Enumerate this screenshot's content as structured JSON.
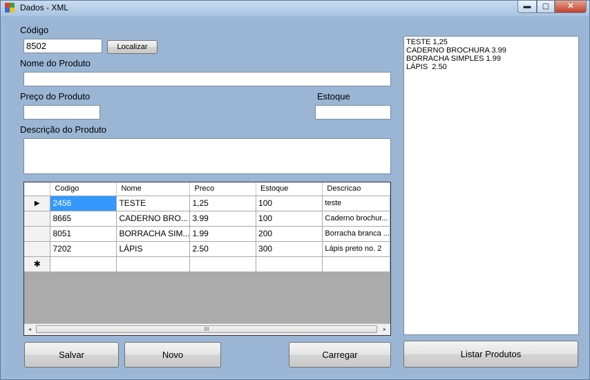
{
  "window": {
    "title": "Dados - XML",
    "min_glyph": "▬",
    "max_glyph": "▢",
    "close_glyph": "✕"
  },
  "form": {
    "codigo_label": "Código",
    "codigo_value": "8502",
    "localizar_label": "Localizar",
    "nome_label": "Nome do Produto",
    "nome_value": "",
    "preco_label": "Preço do Produto",
    "preco_value": "",
    "estoque_label": "Estoque",
    "estoque_value": "",
    "descricao_label": "Descrição do Produto",
    "descricao_value": ""
  },
  "grid": {
    "columns": [
      "Codigo",
      "Nome",
      "Preco",
      "Estoque",
      "Descricao"
    ],
    "rows": [
      {
        "indicator": "▶",
        "codigo": "2456",
        "nome": "TESTE",
        "preco": "1,25",
        "estoque": "100",
        "descricao": "teste"
      },
      {
        "indicator": "",
        "codigo": "8665",
        "nome": "CADERNO BRO...",
        "preco": "3.99",
        "estoque": "100",
        "descricao": "Caderno brochur..."
      },
      {
        "indicator": "",
        "codigo": "8051",
        "nome": "BORRACHA SIM...",
        "preco": "1.99",
        "estoque": "200",
        "descricao": "Borracha branca ..."
      },
      {
        "indicator": "",
        "codigo": "7202",
        "nome": "LÁPIS",
        "preco": "2.50",
        "estoque": "300",
        "descricao": "Lápis preto no. 2"
      }
    ],
    "new_row_indicator": "✱",
    "scroll_left": "◂",
    "scroll_right": "▸",
    "scroll_grip": "III"
  },
  "listbox": {
    "items": [
      "TESTE 1,25",
      "CADERNO BROCHURA 3.99",
      "BORRACHA SIMPLES 1.99",
      "LÁPIS  2.50"
    ]
  },
  "buttons": {
    "salvar": "Salvar",
    "novo": "Novo",
    "carregar": "Carregar",
    "listar": "Listar Produtos"
  }
}
